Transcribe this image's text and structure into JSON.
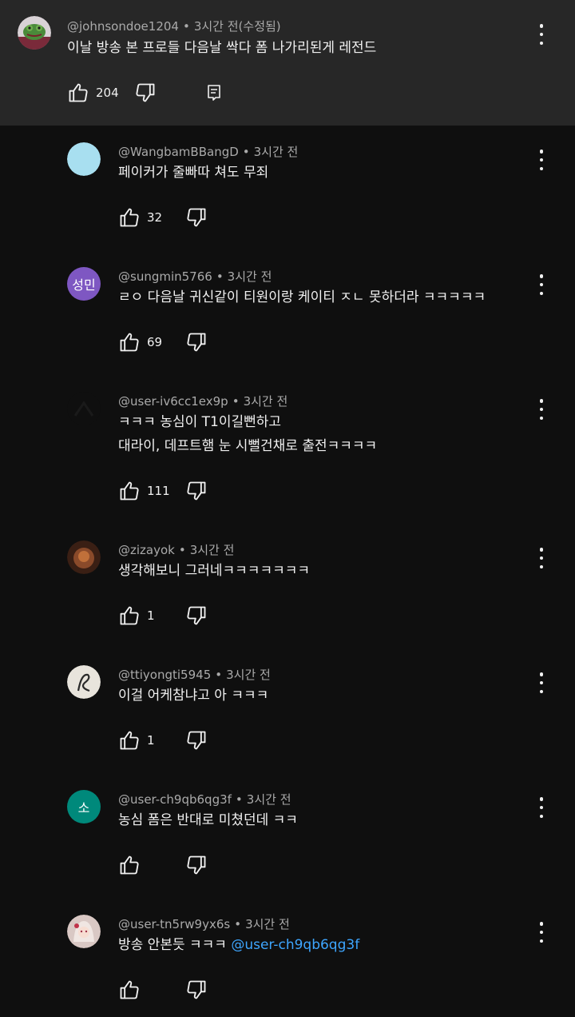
{
  "parent": {
    "handle": "@johnsondoe1204",
    "time": "3시간 전(수정됨)",
    "text": "이날 방송 본 프로들 다음날 싹다 폼 나가리된게 레전드",
    "likes": "204",
    "avatar_icon": "frog-avatar-icon"
  },
  "replies": [
    {
      "handle": "@WangbamBBangD",
      "time": "3시간 전",
      "lines": [
        "페이커가 줄빠따 쳐도 무죄"
      ],
      "likes": "32",
      "avatar_color": "#a8dff0",
      "avatar_text": ""
    },
    {
      "handle": "@sungmin5766",
      "time": "3시간 전",
      "lines": [
        "ㄹㅇ 다음날 귀신같이 티원이랑 케이티 ㅈㄴ 못하더라 ㅋㅋㅋㅋㅋ"
      ],
      "likes": "69",
      "avatar_color": "#7e57c2",
      "avatar_text": "성민"
    },
    {
      "handle": "@user-iv6cc1ex9p",
      "time": "3시간 전",
      "lines": [
        "ㅋㅋㅋ 농심이 T1이길뻔하고",
        "대라이, 데프트햄 눈 시뻘건채로 출전ㅋㅋㅋㅋ"
      ],
      "likes": "111",
      "avatar_color": "#0f0f0f",
      "avatar_text": ""
    },
    {
      "handle": "@zizayok",
      "time": "3시간 전",
      "lines": [
        "생각해보니 그러네ㅋㅋㅋㅋㅋㅋㅋ"
      ],
      "likes": "1",
      "avatar_color": "#6b3a22",
      "avatar_text": ""
    },
    {
      "handle": "@ttiyongti5945",
      "time": "3시간 전",
      "lines": [
        "이걸 어케참냐고 아 ㅋㅋㅋ"
      ],
      "likes": "1",
      "avatar_color": "#e8e4dc",
      "avatar_text": ""
    },
    {
      "handle": "@user-ch9qb6qg3f",
      "time": "3시간 전",
      "lines": [
        "농심 폼은 반대로 미쳤던데 ㅋㅋ"
      ],
      "likes": "",
      "avatar_color": "#00897b",
      "avatar_text": "소"
    },
    {
      "handle": "@user-tn5rw9yx6s",
      "time": "3시간 전",
      "lines": [
        "방송 안본듯 ㅋㅋㅋ "
      ],
      "mention": "@user-ch9qb6qg3f",
      "likes": "",
      "avatar_color": "#d9c8c4",
      "avatar_text": ""
    }
  ],
  "icons": {
    "like": "thumbs-up-icon",
    "dislike": "thumbs-down-icon",
    "reply": "reply-icon",
    "more": "more-vert-icon"
  },
  "colors": {
    "background": "#0f0f0f",
    "parent_background": "#272727",
    "mention": "#3ea6ff",
    "meta": "#aaaaaa"
  }
}
